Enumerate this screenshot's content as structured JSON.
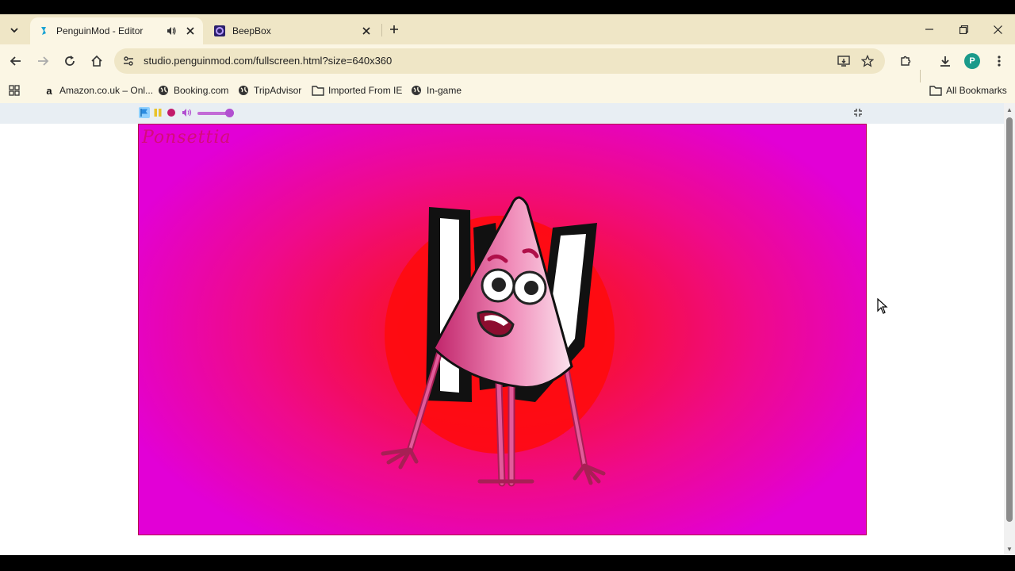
{
  "browser": {
    "tabs": [
      {
        "title": "PenguinMod - Editor",
        "icon": "penguinmod-icon",
        "audio": true,
        "active": true
      },
      {
        "title": "BeepBox",
        "icon": "beepbox-icon",
        "audio": false,
        "active": false
      }
    ],
    "url": "studio.penguinmod.com/fullscreen.html?size=640x360",
    "profile_initial": "P",
    "bookmarks": [
      {
        "label": "Amazon.co.uk – Onl...",
        "icon": "amazon-icon"
      },
      {
        "label": "Booking.com",
        "icon": "globe-icon"
      },
      {
        "label": "TripAdvisor",
        "icon": "globe-icon"
      },
      {
        "label": "Imported From IE",
        "icon": "folder-icon"
      },
      {
        "label": "In-game",
        "icon": "globe-icon"
      }
    ],
    "all_bookmarks_label": "All Bookmarks"
  },
  "player": {
    "controls": [
      "green-flag-icon",
      "pause-icon",
      "stop-icon",
      "volume-icon"
    ],
    "volume_level": 0.85
  },
  "stage": {
    "title_text": "Ponsettia"
  },
  "colors": {
    "accent": "#1aa3a3",
    "stage_center": "#ff1a1f",
    "stage_edge": "#e200d6",
    "profile": "#1a9a8a"
  }
}
